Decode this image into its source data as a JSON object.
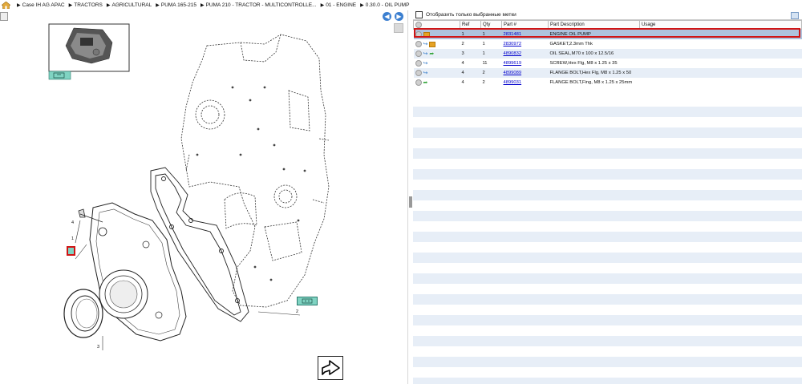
{
  "breadcrumb": {
    "items": [
      "Case IH AG APAC",
      "TRACTORS",
      "AGRICULTURAL",
      "PUMA 165-215",
      "PUMA 210 - TRACTOR - MULTICONTROLLE...",
      "01 - ENGINE",
      "0.30.0 - OIL PUMP"
    ],
    "separator": "▶"
  },
  "diagram": {
    "callouts": [
      "1",
      "2",
      "3",
      "4"
    ]
  },
  "parts_panel": {
    "filter_label": "Отобразить только выбранные метки",
    "columns": [
      "Ref",
      "Qty",
      "Part #",
      "Part Description",
      "Usage"
    ],
    "rows": [
      {
        "ref": "1",
        "qty": "1",
        "part": "2831481",
        "desc": "ENGINE OIL PUMP",
        "usage": "",
        "icons": [
          "box-icon"
        ]
      },
      {
        "ref": "2",
        "qty": "1",
        "part": "2830972",
        "desc": "GASKET,2.3mm Thk",
        "usage": "",
        "icons": [
          "redo-icon",
          "box-icon"
        ]
      },
      {
        "ref": "3",
        "qty": "1",
        "part": "4890832",
        "desc": "OIL SEAL,M70 x 100 x 12.5/16",
        "usage": "",
        "icons": [
          "redo-icon",
          "arrow-icon"
        ]
      },
      {
        "ref": "4",
        "qty": "11",
        "part": "4899619",
        "desc": "SCREW,Hex Flg, M8 x 1.25 x 35",
        "usage": "",
        "icons": [
          "redo-icon"
        ]
      },
      {
        "ref": "4",
        "qty": "2",
        "part": "4899089",
        "desc": "FLANGE BOLT,Hex Flg, M8 x 1.25 x 50",
        "usage": "",
        "icons": [
          "redo-icon"
        ]
      },
      {
        "ref": "4",
        "qty": "2",
        "part": "4899031",
        "desc": "FLANGE BOLT,Fing, M8 x 1.25 x 25mm",
        "usage": "",
        "icons": [
          "arrow-icon"
        ]
      }
    ]
  },
  "colors": {
    "selected_row": "#aec3dd",
    "stripe": "#e7eef7",
    "highlight": "#d01515",
    "link": "#0000cc"
  }
}
